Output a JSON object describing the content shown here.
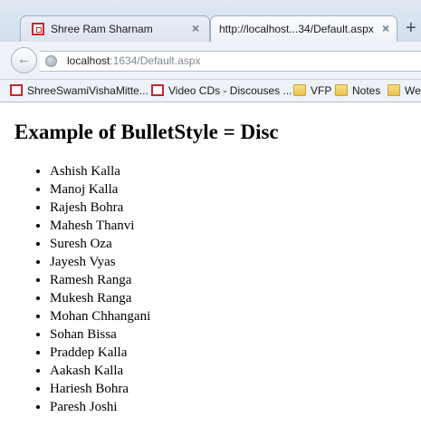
{
  "tabs": [
    {
      "title": "Shree Ram Sharnam",
      "close": "×"
    },
    {
      "title": "http://localhost...34/Default.aspx",
      "close": "×"
    }
  ],
  "new_tab_label": "+",
  "address": {
    "host": "localhost",
    "rest": ":1634/Default.aspx"
  },
  "bookmarks": [
    {
      "label": "ShreeSwamiVishaMitte...",
      "icon": "page-icon"
    },
    {
      "label": "Video CDs - Discouses ...",
      "icon": "page-icon"
    },
    {
      "label": "VFP",
      "icon": "folder-icon"
    },
    {
      "label": "Notes",
      "icon": "folder-icon"
    },
    {
      "label": "We",
      "icon": "folder-icon"
    }
  ],
  "page": {
    "heading": "Example of BulletStyle = Disc",
    "items": [
      "Ashish Kalla",
      "Manoj Kalla",
      "Rajesh Bohra",
      "Mahesh Thanvi",
      "Suresh Oza",
      "Jayesh Vyas",
      "Ramesh Ranga",
      "Mukesh Ranga",
      "Mohan Chhangani",
      "Sohan Bissa",
      "Praddep Kalla",
      "Aakash Kalla",
      "Hariesh Bohra",
      "Paresh Joshi"
    ]
  }
}
